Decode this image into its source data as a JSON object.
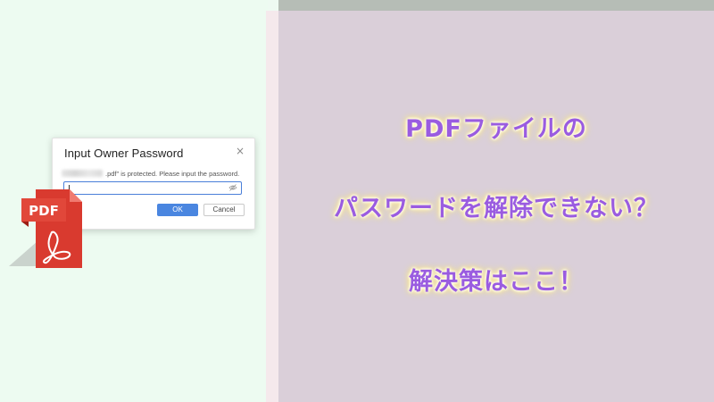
{
  "dialog": {
    "title": "Input Owner Password",
    "close_glyph": "×",
    "message": ".pdf\" is protected. Please input the password.",
    "password_value": "",
    "ok_label": "OK",
    "cancel_label": "Cancel",
    "accent_color": "#4a86e0"
  },
  "pdf_icon": {
    "label": "PDF",
    "color": "#d9312b",
    "icon_name": "pdf-file-icon"
  },
  "headline": {
    "line1": "PDFファイルの",
    "line2": "パスワードを解除できない？",
    "line3": "解決策はここ！",
    "text_color": "#9a5ce0",
    "glow_color": "#ffe680"
  },
  "background": {
    "left_color": "#edfbf1",
    "right_color": "#dacfd9"
  }
}
